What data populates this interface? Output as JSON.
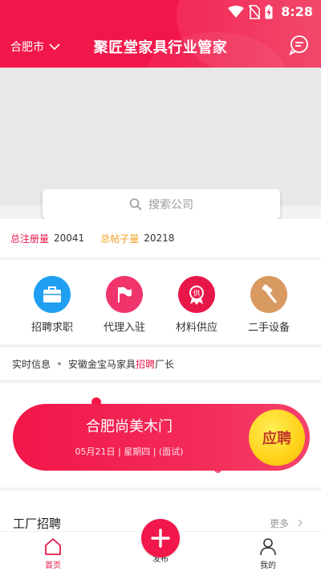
{
  "status": {
    "time": "8:28"
  },
  "header": {
    "city": "合肥市",
    "title": "聚匠堂家具行业管家"
  },
  "search": {
    "placeholder": "搜索公司"
  },
  "stats": {
    "registered_label": "总注册量",
    "registered_value": "20041",
    "posts_label": "总帖子量",
    "posts_value": "20218"
  },
  "categories": [
    {
      "label": "招聘求职",
      "icon": "briefcase-icon",
      "color": "#1e9ff2"
    },
    {
      "label": "代理入驻",
      "icon": "flag-icon",
      "color": "#f0356d"
    },
    {
      "label": "材料供应",
      "icon": "supply-badge-icon",
      "badge": "供",
      "color": "#e8174a"
    },
    {
      "label": "二手设备",
      "icon": "hammer-icon",
      "color": "#d99a62"
    }
  ],
  "news": {
    "label": "实时信息",
    "text_before": "安徽金宝马家具",
    "highlight": "招聘",
    "text_after": "厂长"
  },
  "promo": {
    "title": "合肥尚美木门",
    "subtitle": "05月21日 | 星期四 | (面试)",
    "button": "应聘"
  },
  "factory": {
    "title": "工厂招聘",
    "more": "更多"
  },
  "tabbar": {
    "home": "首页",
    "publish": "发布",
    "mine": "我的"
  },
  "colors": {
    "brand": "#f2174a",
    "accent_yellow": "#ffd21a",
    "stat_orange": "#f0a020"
  }
}
